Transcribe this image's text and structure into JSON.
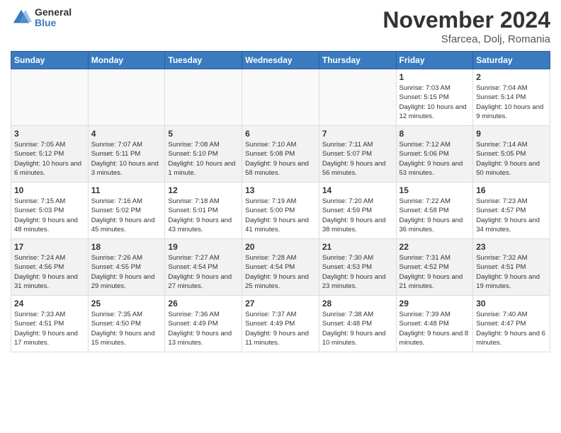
{
  "header": {
    "logo_general": "General",
    "logo_blue": "Blue",
    "month_title": "November 2024",
    "location": "Sfarcea, Dolj, Romania"
  },
  "weekdays": [
    "Sunday",
    "Monday",
    "Tuesday",
    "Wednesday",
    "Thursday",
    "Friday",
    "Saturday"
  ],
  "weeks": [
    [
      {
        "day": "",
        "text": ""
      },
      {
        "day": "",
        "text": ""
      },
      {
        "day": "",
        "text": ""
      },
      {
        "day": "",
        "text": ""
      },
      {
        "day": "",
        "text": ""
      },
      {
        "day": "1",
        "text": "Sunrise: 7:03 AM\nSunset: 5:15 PM\nDaylight: 10 hours and 12 minutes."
      },
      {
        "day": "2",
        "text": "Sunrise: 7:04 AM\nSunset: 5:14 PM\nDaylight: 10 hours and 9 minutes."
      }
    ],
    [
      {
        "day": "3",
        "text": "Sunrise: 7:05 AM\nSunset: 5:12 PM\nDaylight: 10 hours and 6 minutes."
      },
      {
        "day": "4",
        "text": "Sunrise: 7:07 AM\nSunset: 5:11 PM\nDaylight: 10 hours and 3 minutes."
      },
      {
        "day": "5",
        "text": "Sunrise: 7:08 AM\nSunset: 5:10 PM\nDaylight: 10 hours and 1 minute."
      },
      {
        "day": "6",
        "text": "Sunrise: 7:10 AM\nSunset: 5:08 PM\nDaylight: 9 hours and 58 minutes."
      },
      {
        "day": "7",
        "text": "Sunrise: 7:11 AM\nSunset: 5:07 PM\nDaylight: 9 hours and 56 minutes."
      },
      {
        "day": "8",
        "text": "Sunrise: 7:12 AM\nSunset: 5:06 PM\nDaylight: 9 hours and 53 minutes."
      },
      {
        "day": "9",
        "text": "Sunrise: 7:14 AM\nSunset: 5:05 PM\nDaylight: 9 hours and 50 minutes."
      }
    ],
    [
      {
        "day": "10",
        "text": "Sunrise: 7:15 AM\nSunset: 5:03 PM\nDaylight: 9 hours and 48 minutes."
      },
      {
        "day": "11",
        "text": "Sunrise: 7:16 AM\nSunset: 5:02 PM\nDaylight: 9 hours and 45 minutes."
      },
      {
        "day": "12",
        "text": "Sunrise: 7:18 AM\nSunset: 5:01 PM\nDaylight: 9 hours and 43 minutes."
      },
      {
        "day": "13",
        "text": "Sunrise: 7:19 AM\nSunset: 5:00 PM\nDaylight: 9 hours and 41 minutes."
      },
      {
        "day": "14",
        "text": "Sunrise: 7:20 AM\nSunset: 4:59 PM\nDaylight: 9 hours and 38 minutes."
      },
      {
        "day": "15",
        "text": "Sunrise: 7:22 AM\nSunset: 4:58 PM\nDaylight: 9 hours and 36 minutes."
      },
      {
        "day": "16",
        "text": "Sunrise: 7:23 AM\nSunset: 4:57 PM\nDaylight: 9 hours and 34 minutes."
      }
    ],
    [
      {
        "day": "17",
        "text": "Sunrise: 7:24 AM\nSunset: 4:56 PM\nDaylight: 9 hours and 31 minutes."
      },
      {
        "day": "18",
        "text": "Sunrise: 7:26 AM\nSunset: 4:55 PM\nDaylight: 9 hours and 29 minutes."
      },
      {
        "day": "19",
        "text": "Sunrise: 7:27 AM\nSunset: 4:54 PM\nDaylight: 9 hours and 27 minutes."
      },
      {
        "day": "20",
        "text": "Sunrise: 7:28 AM\nSunset: 4:54 PM\nDaylight: 9 hours and 25 minutes."
      },
      {
        "day": "21",
        "text": "Sunrise: 7:30 AM\nSunset: 4:53 PM\nDaylight: 9 hours and 23 minutes."
      },
      {
        "day": "22",
        "text": "Sunrise: 7:31 AM\nSunset: 4:52 PM\nDaylight: 9 hours and 21 minutes."
      },
      {
        "day": "23",
        "text": "Sunrise: 7:32 AM\nSunset: 4:51 PM\nDaylight: 9 hours and 19 minutes."
      }
    ],
    [
      {
        "day": "24",
        "text": "Sunrise: 7:33 AM\nSunset: 4:51 PM\nDaylight: 9 hours and 17 minutes."
      },
      {
        "day": "25",
        "text": "Sunrise: 7:35 AM\nSunset: 4:50 PM\nDaylight: 9 hours and 15 minutes."
      },
      {
        "day": "26",
        "text": "Sunrise: 7:36 AM\nSunset: 4:49 PM\nDaylight: 9 hours and 13 minutes."
      },
      {
        "day": "27",
        "text": "Sunrise: 7:37 AM\nSunset: 4:49 PM\nDaylight: 9 hours and 11 minutes."
      },
      {
        "day": "28",
        "text": "Sunrise: 7:38 AM\nSunset: 4:48 PM\nDaylight: 9 hours and 10 minutes."
      },
      {
        "day": "29",
        "text": "Sunrise: 7:39 AM\nSunset: 4:48 PM\nDaylight: 9 hours and 8 minutes."
      },
      {
        "day": "30",
        "text": "Sunrise: 7:40 AM\nSunset: 4:47 PM\nDaylight: 9 hours and 6 minutes."
      }
    ]
  ]
}
